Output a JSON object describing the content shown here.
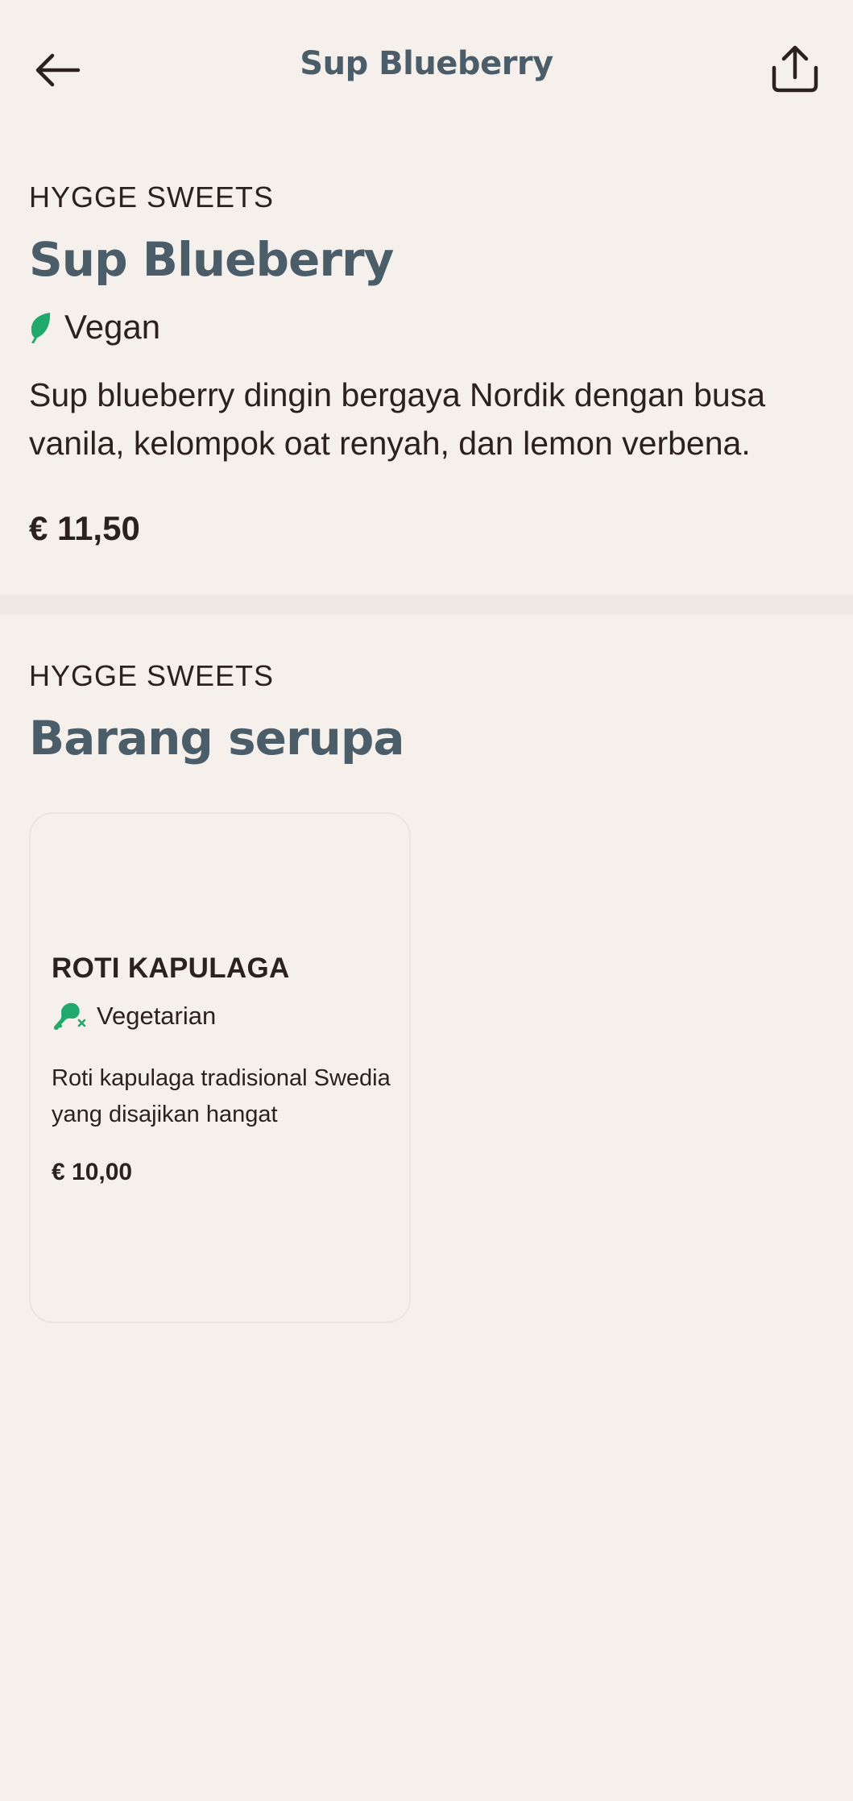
{
  "header": {
    "title": "Sup Blueberry",
    "back_icon": "arrow-left-icon",
    "share_icon": "share-icon"
  },
  "item": {
    "restaurant": "HYGGE SWEETS",
    "name": "Sup Blueberry",
    "diet_label": "Vegan",
    "diet_icon": "leaf-icon",
    "description": "Sup blueberry dingin bergaya Nordik dengan busa vanila, kelompok oat renyah, dan lemon verbena.",
    "price": "€ 11,50"
  },
  "similar": {
    "restaurant": "HYGGE SWEETS",
    "heading": "Barang serupa",
    "items": [
      {
        "name": "ROTI KAPULAGA",
        "diet_label": "Vegetarian",
        "diet_icon": "no-meat-icon",
        "description": "Roti kapulaga tradisional Swedia yang disajikan hangat",
        "price": "€ 10,00"
      }
    ]
  },
  "colors": {
    "background": "#f6f0ec",
    "heading": "#4b5d68",
    "text": "#2b211d",
    "diet_green": "#1faa6b",
    "divider": "#efe8e3"
  }
}
